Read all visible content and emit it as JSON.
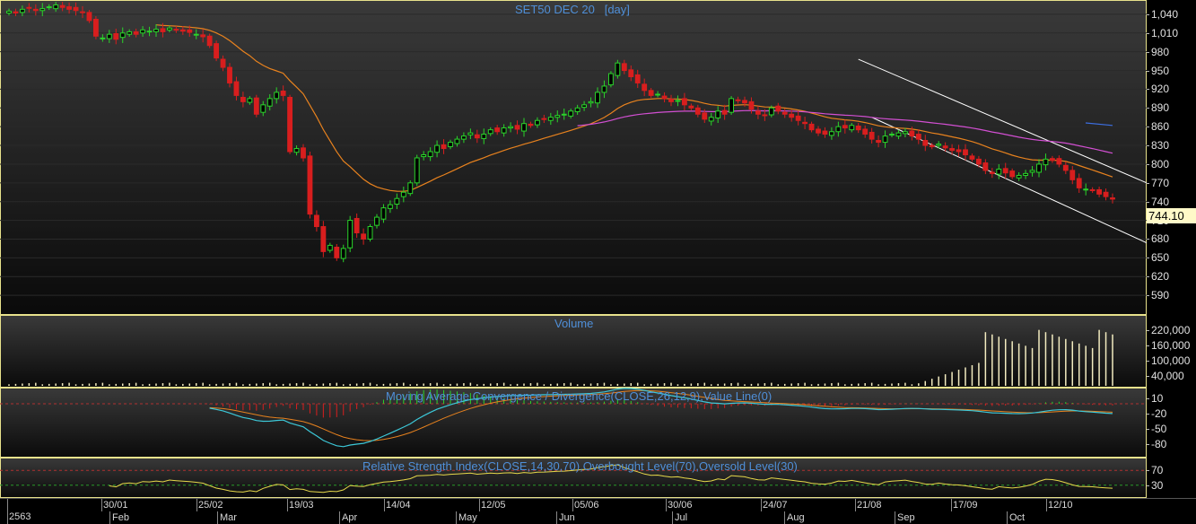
{
  "window": {
    "title": "SET50 DEC 20",
    "period": "[day]",
    "last_price": "744.10"
  },
  "colors": {
    "up": "#2ad42a",
    "down": "#d81e1e",
    "ema_short": "#e8821e",
    "ema_long": "#d24fd2",
    "channel": "#ffffff",
    "pane_border": "#e8e28c",
    "title": "#4f8fd8",
    "volume_bars": "#f3ecc0",
    "macd_line": "#3cc8d8",
    "macd_signal": "#e8821e",
    "rsi_line": "#e6d84a"
  },
  "axes": {
    "price_ticks": [
      "1,040",
      "1,010",
      "980",
      "950",
      "920",
      "890",
      "860",
      "830",
      "800",
      "770",
      "740",
      "710",
      "680",
      "650",
      "620",
      "590"
    ],
    "volume_ticks": [
      "220,000",
      "160,000",
      "100,000",
      "40,000"
    ],
    "macd_ticks": [
      "10",
      "-20",
      "-50",
      "-80"
    ],
    "rsi_ticks": [
      "70",
      "30"
    ],
    "year_label": "2563",
    "day_labels": [
      "30/01",
      "25/02",
      "19/03",
      "14/04",
      "12/05",
      "05/06",
      "30/06",
      "24/07",
      "21/08",
      "17/09",
      "12/10"
    ],
    "month_labels": [
      "Feb",
      "Mar",
      "Apr",
      "May",
      "Jun",
      "Jul",
      "Aug",
      "Sep",
      "Oct"
    ]
  },
  "panes": {
    "volume_title": "Volume",
    "macd_title": "Moving Average Convergence / Divergence(CLOSE,26,12,9),Value Line(0)",
    "rsi_title": "Relative Strength Index(CLOSE,14,30,70),Overbought Level(70),Oversold Level(30)"
  },
  "chart_data": {
    "type": "candlestick",
    "title": "SET50 DEC 20 [day]",
    "ylim": [
      570,
      1060
    ],
    "close_series": [
      [
        1045,
        1042,
        1048,
        1050,
        1046,
        1049,
        1052,
        1055,
        1051,
        1048,
        1046,
        1043,
        1030,
        1005,
        1002,
        1008,
        1000,
        1010,
        1012,
        1008,
        1015,
        1013,
        1016,
        1012,
        1018,
        1015,
        1013,
        1011,
        1008,
        1004,
        990,
        970,
        955,
        930,
        910,
        900,
        905,
        880,
        895,
        905,
        915,
        910,
        820,
        825,
        810,
        720,
        700,
        660,
        670,
        650,
        665,
        710,
        690,
        680,
        700,
        715,
        730,
        735,
        745,
        755,
        770,
        810,
        815,
        820,
        830,
        825,
        835,
        840,
        845,
        850,
        842,
        848,
        855,
        852,
        858,
        860,
        856,
        865,
        862,
        870,
        872,
        875,
        878,
        880,
        885,
        890,
        895,
        900,
        915,
        925,
        945,
        962,
        950,
        940,
        930,
        918,
        910,
        912,
        905,
        900,
        902,
        895,
        890,
        880,
        872,
        875,
        885,
        880,
        905,
        902,
        898,
        888,
        880,
        878,
        890,
        885,
        880,
        875,
        870,
        865,
        855,
        850,
        848,
        852,
        860,
        858,
        862,
        855,
        848,
        840,
        835,
        845,
        848,
        850,
        852,
        845,
        840,
        830,
        828,
        832,
        826,
        822,
        820,
        815,
        808,
        800,
        790,
        785,
        792,
        786,
        780,
        782,
        785,
        790,
        800,
        808,
        806,
        800,
        790,
        775,
        762,
        760,
        758,
        752,
        748,
        744
      ]
    ],
    "ema_short_note": "orange moving average",
    "ema_long_note": "magenta moving average",
    "volume_ylim": [
      0,
      260000
    ],
    "macd_ylim": [
      -100,
      25
    ],
    "rsi_ylim": [
      0,
      100
    ]
  }
}
